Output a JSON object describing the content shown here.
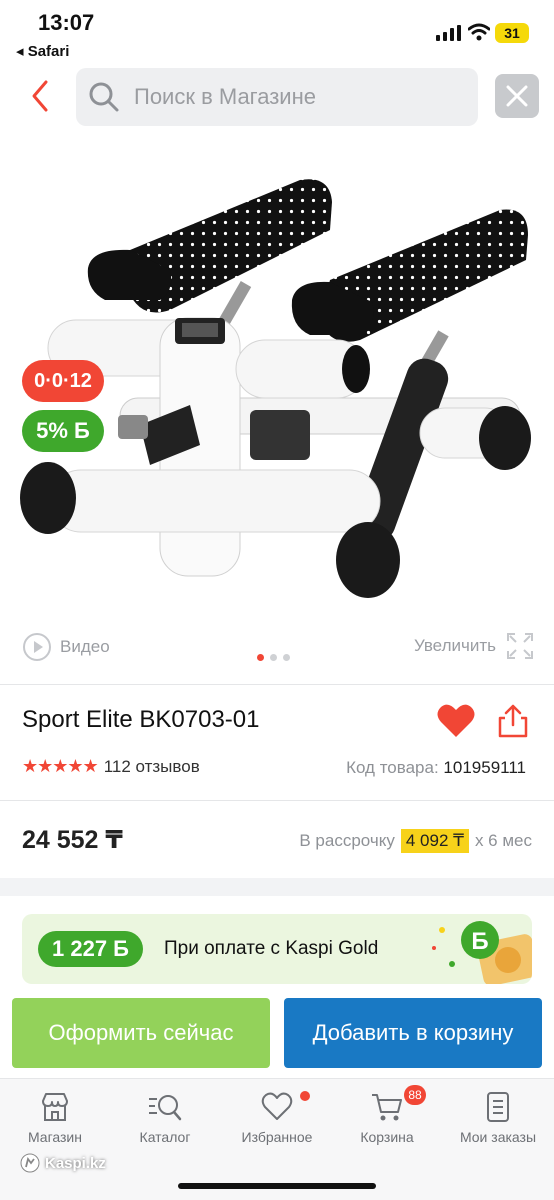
{
  "status_bar": {
    "time": "13:07",
    "back_app": "◂ Safari",
    "battery": "31"
  },
  "search": {
    "placeholder": "Поиск в Магазине"
  },
  "badges": {
    "installment": "0·0·12",
    "bonus": "5% Б"
  },
  "media": {
    "video_label": "Видео",
    "zoom_label": "Увеличить",
    "current_image": 1,
    "image_count": 3
  },
  "product": {
    "title": "Sport Elite BK0703-01",
    "rating_stars": 5,
    "reviews": "112 отзывов",
    "code_label": "Код товара:",
    "code_value": "101959111",
    "price": "24 552 ₸",
    "installment_label": "В рассрочку",
    "installment_amount": "4 092 ₸",
    "installment_term": "х 6 мес"
  },
  "kaspi_gold": {
    "bonus": "1 227 Б",
    "text": "При оплате с Kaspi Gold"
  },
  "actions": {
    "buy_now": "Оформить сейчас",
    "add_to_cart": "Добавить в корзину"
  },
  "tabbar": {
    "items": [
      {
        "label": "Магазин",
        "icon": "store-icon"
      },
      {
        "label": "Каталог",
        "icon": "catalog-icon"
      },
      {
        "label": "Избранное",
        "icon": "heart-icon"
      },
      {
        "label": "Корзина",
        "icon": "cart-icon",
        "badge": "88"
      },
      {
        "label": "Мои заказы",
        "icon": "orders-icon"
      }
    ]
  },
  "watermark": "Kaspi.kz",
  "colors": {
    "accent_red": "#f14635",
    "green": "#3fa82c",
    "blue": "#1979c4",
    "light_green": "#93d25a",
    "yellow": "#f7d21a"
  }
}
